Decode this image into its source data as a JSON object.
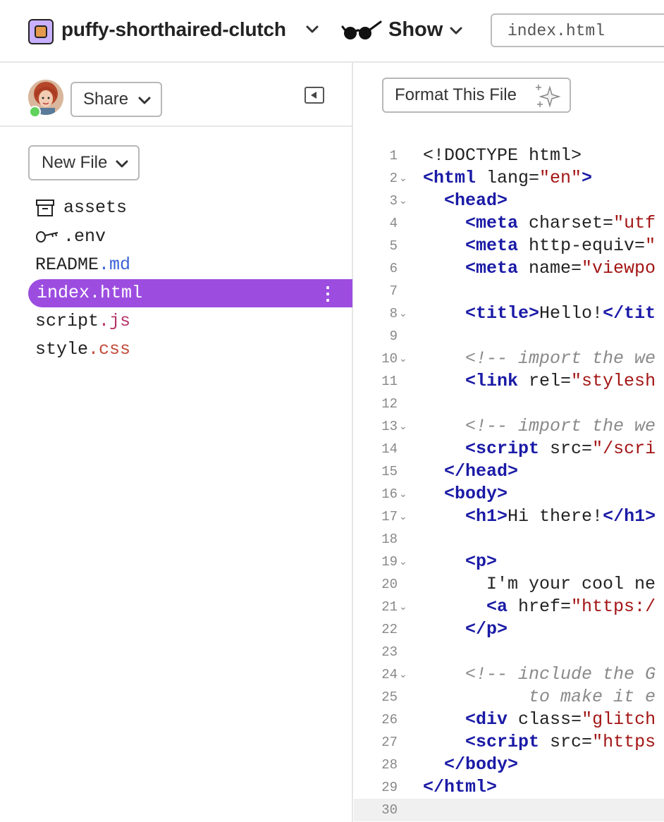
{
  "header": {
    "project_name": "puffy-shorthaired-clutch",
    "show_label": "Show",
    "url_text": "index.html"
  },
  "sidebar": {
    "share_label": "Share",
    "new_file_label": "New File",
    "files": [
      {
        "name": "assets",
        "ext": "",
        "icon": "archive-icon",
        "selected": false
      },
      {
        "name": ".env",
        "ext": "",
        "icon": "key-icon",
        "selected": false
      },
      {
        "name": "README",
        "ext": ".md",
        "selected": false
      },
      {
        "name": "index.html",
        "ext": "",
        "selected": true
      },
      {
        "name": "script",
        "ext": ".js",
        "selected": false
      },
      {
        "name": "style",
        "ext": ".css",
        "selected": false
      }
    ]
  },
  "editor": {
    "format_label": "Format This File",
    "lines": [
      {
        "n": "1",
        "fold": "",
        "segs": [
          [
            "t",
            "<!DOCTYPE html>"
          ]
        ]
      },
      {
        "n": "2",
        "fold": "⌄",
        "segs": [
          [
            "g",
            "<html"
          ],
          [
            "t",
            " lang="
          ],
          [
            "s",
            "\"en\""
          ],
          [
            "g",
            ">"
          ]
        ]
      },
      {
        "n": "3",
        "fold": "⌄",
        "segs": [
          [
            "t",
            "  "
          ],
          [
            "g",
            "<head>"
          ]
        ]
      },
      {
        "n": "4",
        "fold": "",
        "segs": [
          [
            "t",
            "    "
          ],
          [
            "g",
            "<meta"
          ],
          [
            "t",
            " charset="
          ],
          [
            "s",
            "\"utf"
          ]
        ]
      },
      {
        "n": "5",
        "fold": "",
        "segs": [
          [
            "t",
            "    "
          ],
          [
            "g",
            "<meta"
          ],
          [
            "t",
            " http-equiv="
          ],
          [
            "s",
            "\""
          ]
        ]
      },
      {
        "n": "6",
        "fold": "",
        "segs": [
          [
            "t",
            "    "
          ],
          [
            "g",
            "<meta"
          ],
          [
            "t",
            " name="
          ],
          [
            "s",
            "\"viewpo"
          ]
        ]
      },
      {
        "n": "7",
        "fold": "",
        "segs": []
      },
      {
        "n": "8",
        "fold": "⌄",
        "segs": [
          [
            "t",
            "    "
          ],
          [
            "g",
            "<title>"
          ],
          [
            "t",
            "Hello!"
          ],
          [
            "g",
            "</tit"
          ]
        ]
      },
      {
        "n": "9",
        "fold": "",
        "segs": []
      },
      {
        "n": "10",
        "fold": "⌄",
        "segs": [
          [
            "t",
            "    "
          ],
          [
            "c",
            "<!-- import the we"
          ]
        ]
      },
      {
        "n": "11",
        "fold": "",
        "segs": [
          [
            "t",
            "    "
          ],
          [
            "g",
            "<link"
          ],
          [
            "t",
            " rel="
          ],
          [
            "s",
            "\"stylesh"
          ]
        ]
      },
      {
        "n": "12",
        "fold": "",
        "segs": []
      },
      {
        "n": "13",
        "fold": "⌄",
        "segs": [
          [
            "t",
            "    "
          ],
          [
            "c",
            "<!-- import the we"
          ]
        ]
      },
      {
        "n": "14",
        "fold": "",
        "segs": [
          [
            "t",
            "    "
          ],
          [
            "g",
            "<script"
          ],
          [
            "t",
            " src="
          ],
          [
            "s",
            "\"/scri"
          ]
        ]
      },
      {
        "n": "15",
        "fold": "",
        "segs": [
          [
            "t",
            "  "
          ],
          [
            "g",
            "</head>"
          ]
        ]
      },
      {
        "n": "16",
        "fold": "⌄",
        "segs": [
          [
            "t",
            "  "
          ],
          [
            "g",
            "<body>"
          ]
        ]
      },
      {
        "n": "17",
        "fold": "⌄",
        "segs": [
          [
            "t",
            "    "
          ],
          [
            "g",
            "<h1>"
          ],
          [
            "t",
            "Hi there!"
          ],
          [
            "g",
            "</h1>"
          ]
        ]
      },
      {
        "n": "18",
        "fold": "",
        "segs": []
      },
      {
        "n": "19",
        "fold": "⌄",
        "segs": [
          [
            "t",
            "    "
          ],
          [
            "g",
            "<p>"
          ]
        ]
      },
      {
        "n": "20",
        "fold": "",
        "segs": [
          [
            "t",
            "      I'm your cool ne"
          ]
        ]
      },
      {
        "n": "21",
        "fold": "⌄",
        "segs": [
          [
            "t",
            "      "
          ],
          [
            "g",
            "<a"
          ],
          [
            "t",
            " href="
          ],
          [
            "s",
            "\"https:/"
          ]
        ]
      },
      {
        "n": "22",
        "fold": "",
        "segs": [
          [
            "t",
            "    "
          ],
          [
            "g",
            "</p>"
          ]
        ]
      },
      {
        "n": "23",
        "fold": "",
        "segs": []
      },
      {
        "n": "24",
        "fold": "⌄",
        "segs": [
          [
            "t",
            "    "
          ],
          [
            "c",
            "<!-- include the G"
          ]
        ]
      },
      {
        "n": "25",
        "fold": "",
        "segs": [
          [
            "c",
            "          to make it e"
          ]
        ]
      },
      {
        "n": "26",
        "fold": "",
        "segs": [
          [
            "t",
            "    "
          ],
          [
            "g",
            "<div"
          ],
          [
            "t",
            " class="
          ],
          [
            "s",
            "\"glitch"
          ]
        ]
      },
      {
        "n": "27",
        "fold": "",
        "segs": [
          [
            "t",
            "    "
          ],
          [
            "g",
            "<script"
          ],
          [
            "t",
            " src="
          ],
          [
            "s",
            "\"https"
          ]
        ]
      },
      {
        "n": "28",
        "fold": "",
        "segs": [
          [
            "t",
            "  "
          ],
          [
            "g",
            "</body>"
          ]
        ]
      },
      {
        "n": "29",
        "fold": "",
        "segs": [
          [
            "g",
            "</html>"
          ]
        ]
      },
      {
        "n": "30",
        "fold": "",
        "segs": [],
        "active": true
      }
    ]
  },
  "colors": {
    "accent_purple": "#9c4de0",
    "tag_blue": "#1a1aa6",
    "string_red": "#a31515",
    "online_green": "#5fd35c"
  }
}
